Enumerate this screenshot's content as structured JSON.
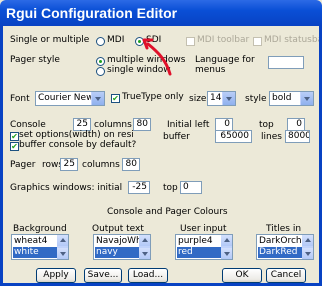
{
  "window": {
    "title": "Rgui Configuration Editor"
  },
  "interface": {
    "label": "Single or multiple",
    "options": [
      "MDI",
      "SDI"
    ],
    "selected": "SDI",
    "mdi_toolbar": "MDI toolbar",
    "mdi_statusbar": "MDI statusbar"
  },
  "pager": {
    "label": "Pager style",
    "options": [
      "multiple windows",
      "single window"
    ],
    "selected": "multiple windows",
    "language_label_1": "Language for",
    "language_label_2": "menus",
    "language_value": ""
  },
  "font": {
    "label": "Font",
    "family": "Courier New",
    "truetype_label": "TrueType only",
    "truetype_checked": true,
    "size_label": "size",
    "size": "14",
    "style_label": "style",
    "style": "bold"
  },
  "console": {
    "label": "Console",
    "rows": "25",
    "columns_label": "columns",
    "columns": "80",
    "initial_left_label": "Initial left",
    "initial_left": "0",
    "top_label": "top",
    "top": "0",
    "set_options_label": "set options(width) on resi",
    "set_options_checked": true,
    "buffer_label": "buffer",
    "buffer": "65000",
    "lines_label": "lines",
    "lines": "8000",
    "buffer_default_label": "buffer console by default?",
    "buffer_default_checked": true
  },
  "pager_size": {
    "label": "Pager",
    "rows_label": "rows",
    "rows": "25",
    "columns_label": "columns",
    "columns": "80"
  },
  "graphics": {
    "label": "Graphics windows: initial",
    "left": "-25",
    "top_label": "top",
    "top": "0"
  },
  "colours": {
    "heading": "Console and Pager Colours",
    "groups": [
      {
        "label": "Background",
        "items": [
          "wheat4",
          "white"
        ],
        "selected": "white"
      },
      {
        "label": "Output text",
        "items": [
          "NavajoWhite",
          "navy"
        ],
        "selected": "navy"
      },
      {
        "label": "User input",
        "items": [
          "purple4",
          "red"
        ],
        "selected": "red"
      },
      {
        "label": "Titles in",
        "items": [
          "DarkOrchid",
          "DarkRed"
        ],
        "selected": "DarkRed"
      }
    ]
  },
  "buttons": {
    "apply": "Apply",
    "save": "Save...",
    "load": "Load...",
    "ok": "OK",
    "cancel": "Cancel"
  },
  "annotation": {
    "color": "#e0102a"
  }
}
